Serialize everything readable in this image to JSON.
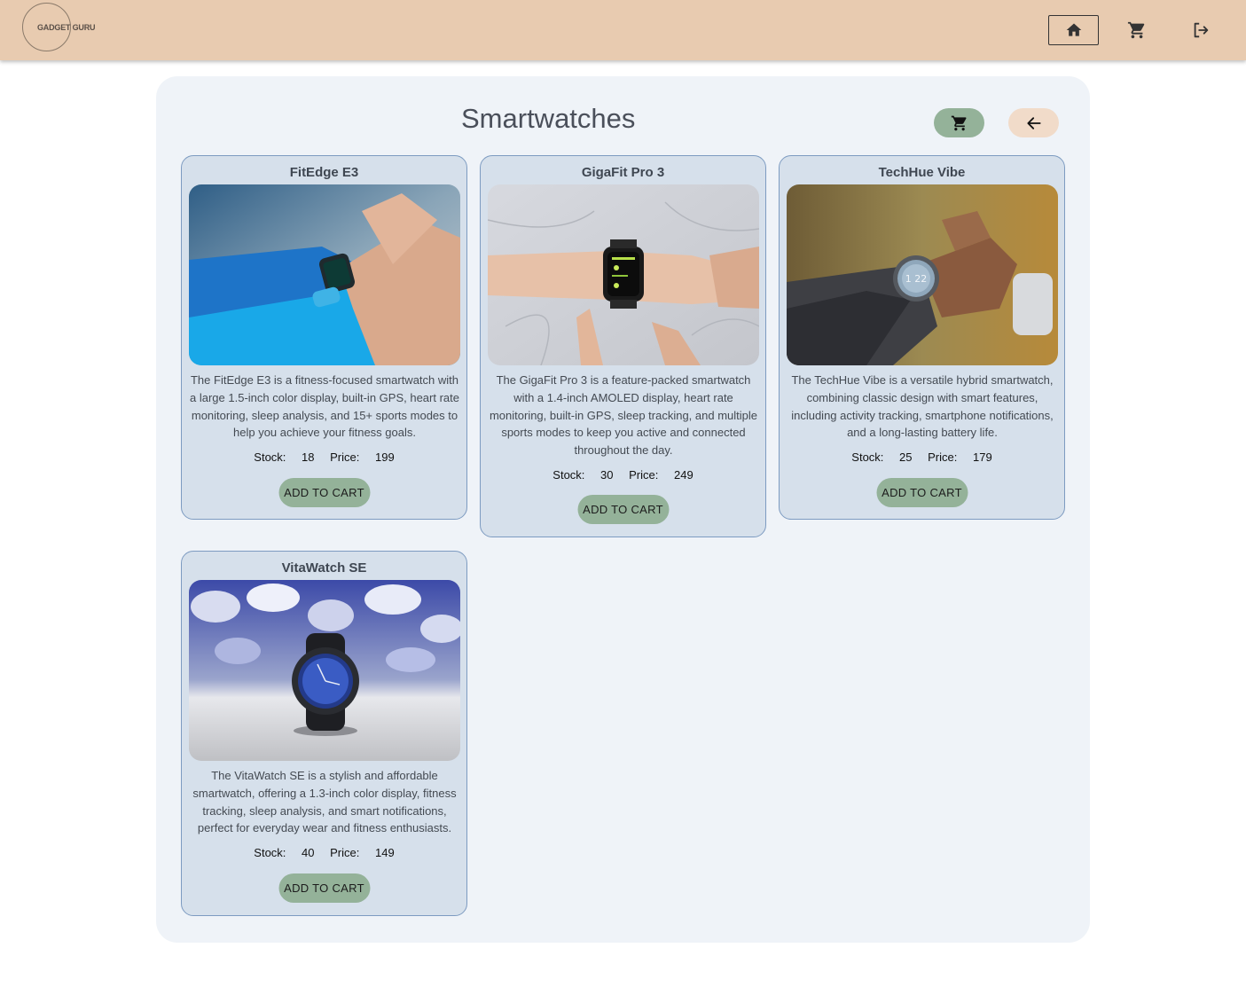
{
  "header": {
    "logo_text": "GADGET GURU",
    "icons": {
      "home": "home-icon",
      "cart": "cart-icon",
      "logout": "logout-icon"
    },
    "background": "#e8cbb0"
  },
  "page": {
    "title": "Smartwatches",
    "accent_green": "#94b299",
    "accent_peach": "#f1dbc9"
  },
  "labels": {
    "stock": "Stock:",
    "price": "Price:",
    "add_to_cart": "ADD TO CART"
  },
  "products": [
    {
      "name": "FitEdge E3",
      "description": "The FitEdge E3 is a fitness-focused smartwatch with a large 1.5-inch color display, built-in GPS, heart rate monitoring, sleep analysis, and 15+ sports modes to help you achieve your fitness goals.",
      "stock": "18",
      "price": "199",
      "image": "wrist-smartwatch-blue-sleeve"
    },
    {
      "name": "GigaFit Pro 3",
      "description": "The GigaFit Pro 3 is a feature-packed smartwatch with a 1.4-inch AMOLED display, heart rate monitoring, built-in GPS, sleep tracking, and multiple sports modes to keep you active and connected throughout the day.",
      "stock": "30",
      "price": "249",
      "image": "wrist-smartwatch-marble"
    },
    {
      "name": "TechHue Vibe",
      "description": "The TechHue Vibe is a versatile hybrid smartwatch, combining classic design with smart features, including activity tracking, smartphone notifications, and a long-lasting battery life.",
      "stock": "25",
      "price": "179",
      "image": "wrist-round-smartwatch"
    },
    {
      "name": "VitaWatch SE",
      "description": "The VitaWatch SE is a stylish and affordable smartwatch, offering a 1.3-inch color display, fitness tracking, sleep analysis, and smart notifications, perfect for everyday wear and fitness enthusiasts.",
      "stock": "40",
      "price": "149",
      "image": "round-smartwatch-on-stones"
    }
  ]
}
